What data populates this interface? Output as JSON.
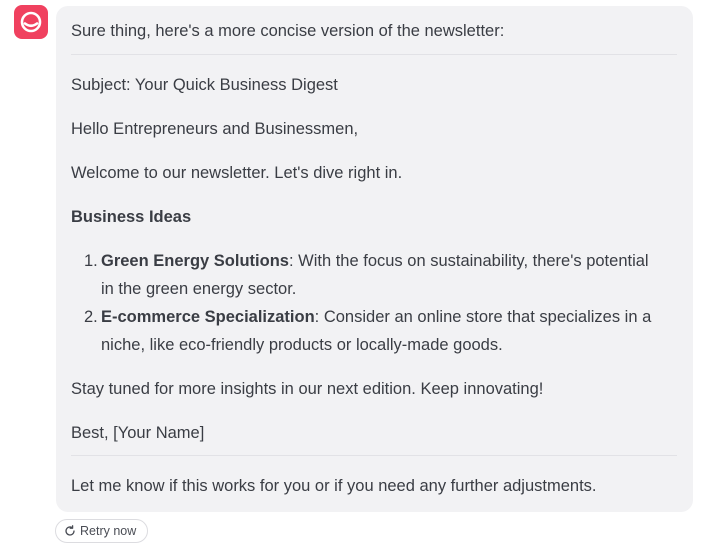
{
  "assistant": {
    "avatar_icon": "assistant-logo-icon",
    "avatar_color": "#f0415f"
  },
  "message": {
    "intro": "Sure thing, here's a more concise version of the newsletter:",
    "subject": "Subject: Your Quick Business Digest",
    "greeting": "Hello Entrepreneurs and Businessmen,",
    "welcome": "Welcome to our newsletter. Let's dive right in.",
    "section_heading": "Business Ideas",
    "items": [
      {
        "number": "1.",
        "title": "Green Energy Solutions",
        "text_line1": ": With the focus on sustainability, there's potential",
        "text_line2": "in the green energy sector."
      },
      {
        "number": "2.",
        "title": "E-commerce Specialization",
        "text_line1": ": Consider an online store that specializes in a",
        "text_line2": "niche, like eco-friendly products or locally-made goods."
      }
    ],
    "closing": "Stay tuned for more insights in our next edition. Keep innovating!",
    "signoff": "Best, [Your Name]",
    "outro": "Let me know if this works for you or if you need any further adjustments."
  },
  "actions": {
    "retry_label": "Retry now",
    "retry_icon": "retry-icon"
  }
}
